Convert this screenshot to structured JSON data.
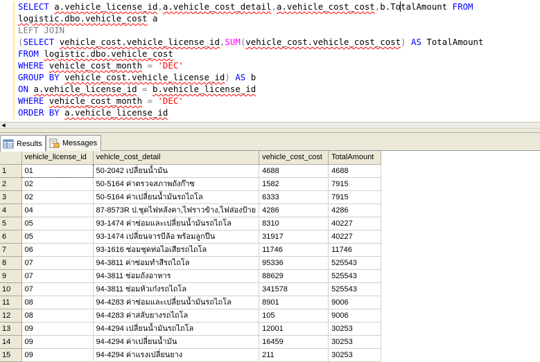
{
  "editor": {
    "lines": [
      [
        {
          "t": "SELECT ",
          "c": "kw"
        },
        {
          "t": "a.vehicle_license_id",
          "c": "sq"
        },
        {
          "t": ",",
          "c": "gray"
        },
        {
          "t": "a.vehicle_cost_detail",
          "c": "sq"
        },
        {
          "t": ",",
          "c": "gray"
        },
        {
          "t": "a.vehicle_cost_cost",
          "c": "sq"
        },
        {
          "t": ",",
          "c": "gray"
        },
        {
          "t": "b.TotalAmount ",
          "c": ""
        },
        {
          "t": "FROM",
          "c": "kw"
        }
      ],
      [
        {
          "t": "logistic.dbo.vehicle_cost",
          "c": "sq"
        },
        {
          "t": " a",
          "c": ""
        }
      ],
      [
        {
          "t": "LEFT JOIN",
          "c": "gray"
        }
      ],
      [
        {
          "t": "(",
          "c": "gray"
        },
        {
          "t": "SELECT ",
          "c": "kw"
        },
        {
          "t": "vehicle_cost.vehicle_license_id",
          "c": "sq"
        },
        {
          "t": ",",
          "c": "gray"
        },
        {
          "t": "SUM",
          "c": "fn"
        },
        {
          "t": "(",
          "c": "gray"
        },
        {
          "t": "vehicle_cost.vehicle_cost_cost",
          "c": "sq"
        },
        {
          "t": ") ",
          "c": "gray"
        },
        {
          "t": "AS ",
          "c": "kw"
        },
        {
          "t": "TotalAmount",
          "c": ""
        }
      ],
      [
        {
          "t": "FROM ",
          "c": "kw"
        },
        {
          "t": "logistic.dbo.vehicle_cost",
          "c": "sq"
        }
      ],
      [
        {
          "t": "WHERE ",
          "c": "kw"
        },
        {
          "t": "vehicle_cost_month",
          "c": "sq"
        },
        {
          "t": " = ",
          "c": "gray"
        },
        {
          "t": "'DEC'",
          "c": "str"
        }
      ],
      [
        {
          "t": "GROUP BY ",
          "c": "kw"
        },
        {
          "t": "vehicle_cost.vehicle_license_id",
          "c": "sq"
        },
        {
          "t": ") ",
          "c": "gray"
        },
        {
          "t": "AS ",
          "c": "kw"
        },
        {
          "t": "b",
          "c": ""
        }
      ],
      [
        {
          "t": "ON ",
          "c": "kw"
        },
        {
          "t": "a.vehicle_license_id",
          "c": "sq"
        },
        {
          "t": " = ",
          "c": "gray"
        },
        {
          "t": "b.vehicle_license_id",
          "c": "sq"
        }
      ],
      [
        {
          "t": "WHERE ",
          "c": "kw"
        },
        {
          "t": "vehicle_cost_month",
          "c": "sq"
        },
        {
          "t": " = ",
          "c": "gray"
        },
        {
          "t": "'DEC'",
          "c": "str"
        }
      ],
      [
        {
          "t": "ORDER BY ",
          "c": "kw"
        },
        {
          "t": "a.vehicle_license_id",
          "c": "sq"
        }
      ]
    ]
  },
  "tabs": {
    "results": "Results",
    "messages": "Messages"
  },
  "grid": {
    "columns": [
      "vehicle_license_id",
      "vehicle_cost_detail",
      "vehicle_cost_cost",
      "TotalAmount"
    ],
    "rows": [
      [
        "1",
        "01",
        "50-2042 เปลี่ยนน้ำมัน",
        "4688",
        "4688"
      ],
      [
        "2",
        "02",
        "50-5164 ค่าตรวจสภาพถังก๊าซ",
        "1582",
        "7915"
      ],
      [
        "3",
        "02",
        "50-5164 ค่าเปลี่ยนน้ำมันรถไถโล",
        "6333",
        "7915"
      ],
      [
        "4",
        "04",
        "87-8573R ป.ชุดไฟหลังคา,ไฟราวข้าง,ไฟส่องป้าย",
        "4286",
        "4286"
      ],
      [
        "5",
        "05",
        "93-1474 ค่าซ่อมและเปลี่ยนน้ำมันรถไถโล",
        "8310",
        "40227"
      ],
      [
        "6",
        "05",
        "93-1474 เปลี่ยนจารบีล้อ พร้อมลูกปืน",
        "31917",
        "40227"
      ],
      [
        "7",
        "06",
        "93-1616 ซ่อมชุดท่อไอเสียรถไถโล",
        "11746",
        "11746"
      ],
      [
        "8",
        "07",
        "94-3811 ค่าซ่อมทำสีรถไถโล",
        "95336",
        "525543"
      ],
      [
        "9",
        "07",
        "94-3811 ซ่อมถังอาหาร",
        "88629",
        "525543"
      ],
      [
        "10",
        "07",
        "94-3811 ซ่อมหัวเก๋งรถไถโล",
        "341578",
        "525543"
      ],
      [
        "11",
        "08",
        "94-4283 ค่าซ่อมและเปลี่ยนน้ำมันรถไถโล",
        "8901",
        "9006"
      ],
      [
        "12",
        "08",
        "94-4283 ค่าสลับยางรถไถโล",
        "105",
        "9006"
      ],
      [
        "13",
        "09",
        "94-4294 เปลี่ยนน้ำมันรถไถโล",
        "12001",
        "30253"
      ],
      [
        "14",
        "09",
        "94-4294 ค่าเปลี่ยนน้ำมัน",
        "16459",
        "30253"
      ],
      [
        "15",
        "09",
        "94-4294 ค่าแรงเปลี่ยนยาง",
        "211",
        "30253"
      ]
    ]
  },
  "colors": {
    "keyword": "#0000ff",
    "comment_gray": "#808080",
    "function": "#ff00ff",
    "string": "#ff0000",
    "squiggle": "#ff0000",
    "chrome": "#ece9d8"
  },
  "icons": [
    "grid-results-icon",
    "messages-icon",
    "scroll-left-arrow-icon"
  ]
}
